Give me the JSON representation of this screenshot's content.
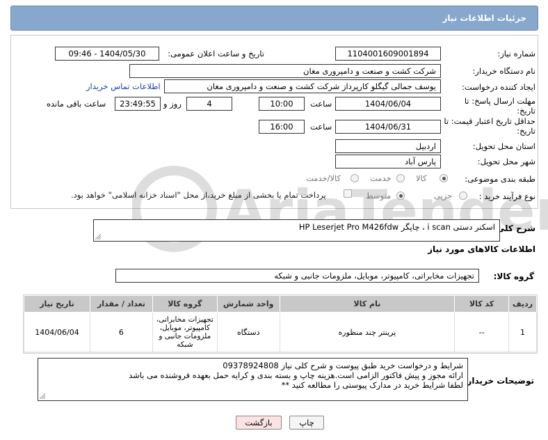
{
  "header": {
    "title": "جزئیات اطلاعات نیاز"
  },
  "labels": {
    "need_number": "شماره نیاز:",
    "announce_date": "تاریخ و ساعت اعلان عمومی:",
    "buyer_org": "نام دستگاه خریدار:",
    "requester": "ایجاد کننده درخواست:",
    "reply_deadline": "مهلت ارسال پاسخ: تا تاریخ:",
    "price_validity": "حداقل تاریخ اعتبار قیمت: تا تاریخ:",
    "time": "ساعت",
    "day_and": "روز و",
    "hours_left": "ساعت باقی مانده",
    "province": "استان محل تحویل:",
    "city": "شهر محل تحویل:",
    "category": "طبقه بندی موضوعی:",
    "purchase_type": "نوع فرآیند خرید :",
    "general_desc": "شرح کلی نیاز:",
    "goods_info": "اطلاعات کالاهای مورد نیاز",
    "goods_group": "گروه کالا:",
    "buyer_notes": "توضیحات خریدار:"
  },
  "values": {
    "need_number": "1104001609001894",
    "announce_datetime": "1404/05/30 - 09:46",
    "buyer_org": "شرکت کشت و صنعت و دامپروری مغان",
    "requester": "یوسف جمالی گیگلو کارپرداز شرکت کشت و صنعت و دامپروری مغان",
    "buyer_contact_link": "اطلاعات تماس خریدار",
    "reply_date": "1404/06/04",
    "reply_time": "10:00",
    "days": "4",
    "remaining": "23:49:55",
    "validity_date": "1404/06/31",
    "validity_time": "16:00",
    "province": "اردبیل",
    "city": "پارس آباد",
    "general_desc": "اسکنر دستی  i scan ، چاپگر HP Leserjet Pro M426fdw",
    "goods_group": "تجهیزات مخابراتی، کامپیوتر، موبایل، ملزومات جانبی و شبکه",
    "buyer_notes_line1": "شرایط و درخواست خرید طبق پیوست و شرح کلی نیاز 09378924808",
    "buyer_notes_line2": "ارائه مجوز و پیش فاکتور الزامی است.هزینه چاپ و بسته بندی و کرایه حمل بعهده فروشنده می باشد",
    "buyer_notes_line3": "لطفا شرایط خرید در مدارک پیوستی را مطالعه کنید **"
  },
  "category_options": {
    "goods": "کالا",
    "service": "خدمت",
    "goods_service": "کالا/خدمت"
  },
  "purchase_options": {
    "partial": "جزیی",
    "medium": "متوسط",
    "treasury_note": "پرداخت تمام یا بخشی از مبلغ خرید،از محل \"اسناد خزانه اسلامی\" خواهد بود."
  },
  "table": {
    "headers": [
      "ردیف",
      "کد کالا",
      "نام کالا",
      "واحد شمارش",
      "گروه کالا",
      "تعداد / مقدار",
      "تاریخ نیاز"
    ],
    "rows": [
      [
        "1",
        "--",
        "پرینتر چند منظوره",
        "دستگاه",
        "تجهیزات مخابراتی، کامپیوتر، موبایل، ملزومات جانبی و شبکه",
        "6",
        "1404/06/04"
      ]
    ]
  },
  "buttons": {
    "print": "چاپ",
    "back": "بازگشت"
  },
  "watermark": "AriaTender.neT",
  "colors": {
    "header_bg": "#87a7cd",
    "link": "#1a3fa8",
    "back_button_bg": "#fbe3e3"
  }
}
